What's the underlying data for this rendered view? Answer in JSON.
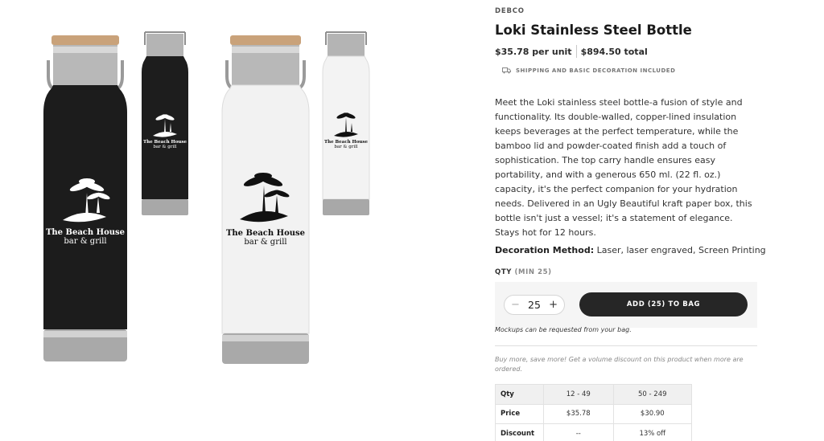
{
  "product": {
    "brand": "DEBCO",
    "title": "Loki Stainless Steel Bottle",
    "price_unit": "$35.78 per unit",
    "price_total": "$894.50 total",
    "shipping_note": "SHIPPING AND BASIC DECORATION INCLUDED",
    "description": "Meet the Loki stainless steel bottle-a fusion of style and functionality. Its double-walled, copper-lined insulation keeps beverages at the perfect temperature, while the bamboo lid and powder-coated finish add a touch of sophistication. The top carry handle ensures easy portability, and with a generous 650 ml. (22 fl. oz.) capacity, it's the perfect companion for your hydration needs. Delivered in an Ugly Beautiful kraft paper box, this bottle isn't just a vessel; it's a statement of elegance. Stays hot for 12 hours.",
    "decoration_label": "Decoration Method:",
    "decoration_value": " Laser, laser engraved, Screen Printing"
  },
  "quantity": {
    "label": "QTY",
    "min_label": "(MIN 25)",
    "value": "25",
    "minus": "−",
    "plus": "+",
    "add_button": "ADD (25) TO BAG",
    "mockup_note": "Mockups can be requested from your bag."
  },
  "volume": {
    "note": "Buy more, save more! Get a volume discount on this product when more are ordered.",
    "table": {
      "header": [
        "Qty",
        "12 - 49",
        "50 - 249"
      ],
      "rows": [
        [
          "Price",
          "$35.78",
          "$30.90"
        ],
        [
          "Discount",
          "--",
          "13% off"
        ]
      ]
    }
  },
  "bottle_logo": {
    "line1": "The Beach House",
    "line2": "bar & grill"
  }
}
